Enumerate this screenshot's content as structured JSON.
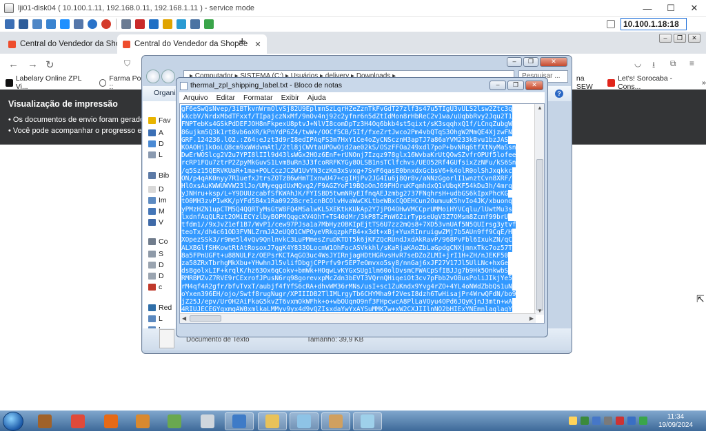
{
  "remote_desktop": {
    "title": "lji01-disk04 ( 10.100.1.11, 192.168.0.11, 192.168.1.11 ) - service mode",
    "address": "10.100.1.18:18",
    "window_controls": [
      "—",
      "☐",
      "✕"
    ]
  },
  "browser": {
    "tabs": [
      {
        "label": "Central do Vendedor da Shopee",
        "close": "✕"
      },
      {
        "label": "Central do Vendedor da Shopee",
        "close": "✕"
      }
    ],
    "new_tab": "+",
    "nav": {
      "back": "←",
      "forward": "→",
      "reload": "↻"
    },
    "bookmarks": [
      {
        "label": "Labelary Online ZPL Vi...",
        "color": "#111111"
      },
      {
        "label": "Farma Ponte ::",
        "color": "#555555"
      },
      {
        "label": "na SEW",
        "color": "#888888"
      },
      {
        "label": "Let's! Sorocaba - Cons...",
        "color": "#e1251b"
      }
    ],
    "page": {
      "heading": "Visualização de impressão",
      "bullets": [
        "Os documentos de envio foram gerado",
        "Você pode acompanhar o progresso en"
      ]
    }
  },
  "explorer": {
    "address": "▸ Computador ▸ SISTEMA (C:) ▸ Usuários ▸ delivery ▸ Downloads ▸",
    "search_placeholder": "Pesquisar ...",
    "command_label": "Organizar",
    "help_glyph": "?",
    "sidebar": [
      {
        "label": "Fav",
        "color": "#e8b400"
      },
      {
        "label": "A",
        "color": "#3b6fb5"
      },
      {
        "label": "D",
        "color": "#4a8ad4"
      },
      {
        "label": "L",
        "color": "#8a9ab0"
      },
      {
        "label": "Bib",
        "color": "#5c7aa6"
      },
      {
        "label": "D",
        "color": "#d8d8d8"
      },
      {
        "label": "Im",
        "color": "#5d8bc2"
      },
      {
        "label": "M",
        "color": "#4476b8"
      },
      {
        "label": "V",
        "color": "#3f6aa8"
      },
      {
        "label": "Co",
        "color": "#707c8c"
      },
      {
        "label": "S",
        "color": "#8e9aa8"
      },
      {
        "label": "D",
        "color": "#9aa4b0"
      },
      {
        "label": "D",
        "color": "#9aa4b0"
      },
      {
        "label": "c",
        "color": "#c0392b"
      },
      {
        "label": "Red",
        "color": "#2f6ea8"
      },
      {
        "label": "L",
        "color": "#5a88bf"
      },
      {
        "label": "L",
        "color": "#5a88bf"
      }
    ],
    "status": {
      "type": "Documento de Texto",
      "size": "Tamanho: 39,9 KB"
    }
  },
  "notepad": {
    "title": "thermal_zpl_shipping_label.txt - Bloco de notas",
    "menu": [
      "Arquivo",
      "Editar",
      "Formatar",
      "Exibir",
      "Ajuda"
    ],
    "lines": [
      "gF6eSwQsNvep/3iBTkvnWrmOlvSj82U9EplmnSzLqrHZeZznTkFvGdT27zlf3s47u5TIgU3vULS2lsw2Ztc3q",
      "kkcbV/NrdxMbdTFxxf/TIpajczNxMf/9nOv4nj92c2yfnr6n5dZtIdMon8rHbReC2v1wa/uUqbbRvy2Jqu2T1",
      "FNPTebKs4GSkPdDEFJOH8nFkpexU8ptvJ+NlVI8comDpTz3H4Oq6bkb4st5qixt/sK3sqqhxQ1f/LCnqZubgW",
      "86ujkm5Q3k1rt8vb6oXR/kPnYdP6Z4/twW+/OOCf5CB/5If/fxeZrtJwco2Pm4vbQTqS3OhgW2MmQE4XjzwFN",
      "GRF.124236.lO2.:Z64:eJzt3d9rI8edIPAqFS3m7HxY1Ce4oZyCNScznH3apTJ7a86aYVM233kBvu1bzJAS",
      "KOAOHj1kOoLQ8cm9xWWdvmAtl/2tl8jCWVtaUPOwOjd2ae02kS/OSzFFOa249xdl7poP+bvNRq6tfXtNyMaSsn",
      "DwErWOSlcg2V2u7YPI8lIIl9d43lsWGx2HOz6EnF+rUNOnj7Izqz978glx16WvbaKrUtQOwSZvfrOPUf5lofee",
      "rcRP1FQu7ztrP2ZpyMkGuvS1LvmBuRn3J3fcoRRFKYGy8OLSB1nsTClfchvs/UEO52Rf4GUfsixZzNFu/kS6Sn",
      "/q5Sz15QERVKUaR+1ma+POLCczJC2W1UvYN3czKm3xSvxg+7SvF6qasE0bnxdxGcbsV6+k4olR0olShJxqkkc",
      "ON/p4qAK0nyy7R1uefxJtrsZOTzB6wHmTIxnwU47+cgIHjPv2JG4Iu6j8Qr8v/aNNzGgorlI1wnztCvn8XRF/",
      "HlOxsAuKWWUWVW23lJo/UMyeggdUxMQvg2/F9AGZYoF19BQoOnJ69FHOruKFqmhdxQ1vUbqKF54kDu3h/4mrq",
      "yJNHru+ksp/L+Y9DUUzcabfSfKWAhJK/FYISBD5twmNRyEIfnqAEJzmbg2737FNqhrsH+udbGS6kIpxPhcKG",
      "tO0MH3zvPIwKK/pYFd5B4x1Ra0922Bcre1cnBCOlvHvaWwCKLtbeWBxCQOEHCun2OumuuK5hvIo4JK/xbuonq",
      "yPMzHZN1upCTM5Q4QQRTyMsGtW8FQ4MSalwKL5XEKtkKUkAp2Y7jPO4OHwVMCCprUMMoiHYVCqlu/lUwtMu3s",
      "lxdnfAqQLRzt2OMiECYzlbyBOPMQqgcKV4OhT+TS40dMr/3kP8TzPnW62irTypseUgV3Z7OMsm8Zcmf99brU",
      "tfdm1//9xJvZ1ef1B7/WvP1/cew97PJsa1a7MbHyzOBKIpEjtTS6U7zz2mQs8+7XD53vnUAf5N5QUIrsg3ytvf",
      "teoTx/dh4c61OD3FVNLZrmJA2eUQ01CWPOyeVRkqzpkFB4+x3dt+xBj+YuxRInruigwZMj7b5AUn9ff9CqE/H",
      "XOpezSSk3/r9me5l4vQv9QnlnvkC3LuPMmesZruDKTDT5k6jKFZQcRUndJxdAkRavP/968PvFbl6IxukZN/qC",
      "ALXBGlfSHKowtRtAtRosoxJ7qgK4Y833OLocmW1OhFocASVkkhl/sKaRjaKAoZbLaGpdgCNXjmnxTkc7oz57T",
      "8a5FPnUGFt+u88NULFz/OEPsrKCTAqGO3uc4WsJYIRnjagHDtHGRvsHvR7seDZoZLMI+jrI1H+ZH/nJEKF50",
      "za58ZRxTbrhgMkXbu+YHwhnJl5vlifDbgjCPPrfv9r5EP7eOmvxo5sy8/nnGaj6xJF27V17Jl5UlLNc+hxGe",
      "dsBgolxLIF+krqlK/hz63Ox6qCokv+bmWk+HOqwLvKYGxSUg1lm60olDvsmCFWACpSfIBJJg7b9Hk5OnkwbS",
      "RMRBMZvZ7RVE9rCExrofJPusN6rq98gorevxpMcZdn3bEVT3VQrnQHiqeiOt3cv7pFbb2vOBusPoliJIkjYe5",
      "rM4qf4A2gfr/bfvTvxT/aubjf4fYfS6cRA+dhvWM36rMNs/usI+sc1ZuKndx9Yvg4rZO+4YL4oNWdZbbQs1uN",
      "oYxen396EH/ojo/Swtf8rugNugr/XPIIIDB2TlIMLrgyTb6CHYMha9f2VesI8dzh6TwHisajPr4WrwQFdN/bo9",
      "jZ25J/epv/UrOH2AiFkaG5kvZT6vxmOkWFhk+o+wbOUqnO9nf3FHpcwcA8PlLaVOyu4OPd6JQyKjnJ3mtn+wA",
      "4RIUJECEGYqxmgAW0xmlkaLMMyv9yx4d9vQZIsxdaYwYxAYSuMMK7w+xW2CXJIIlnNO2bHIExYNEmnlaglagY",
      "b/vwZUqy7Tb0iu3ckdj24blGJMO4e3jYqUX2HyYlZ1q6GZS+3A+OkVHRTPONVR4QYtESQJDRTcq8WiVXVRUBOD",
      "L8D+mtZbHVNLx3Ix8Rx0zJ8DnxlyxmmODy9IqI+Zq7k3wF5KEGcmPUNbP33x1lwMy1ThtvgrcKyymkR49tg",
      "ZvGOTdDL+sqq9sOEA5z4VOMLKy/I6fYrbO0UZAoQ8yOhFFOs+lhIGp3A5yX3pp+2oP5Z4qD1GJ89xHmwxg7fe",
      "fqa9TxsO5Tx/amiFu9lrTf7Nd9xCyP6eO8Pc+w/ExAhdofthe3IlVEiBAhQoSIIGy3SBwpbptpuahAuZf2s+H"
    ]
  },
  "taskbar": {
    "apps": [
      {
        "name": "file-manager-icon",
        "color": "#a0622a"
      },
      {
        "name": "chrome-icon",
        "color": "#e04a3a"
      },
      {
        "name": "firefox-icon",
        "color": "#e66a16"
      },
      {
        "name": "user-app-icon",
        "color": "#d9892f"
      },
      {
        "name": "tools-icon",
        "color": "#6aa84f"
      },
      {
        "name": "printer-icon",
        "color": "#cfd6dd"
      },
      {
        "name": "vida-link-icon",
        "color": "#3e7bc7"
      },
      {
        "name": "folder-icon",
        "color": "#e8c25a"
      },
      {
        "name": "notepad-icon",
        "color": "#8ec3e6"
      },
      {
        "name": "paint-icon",
        "color": "#d0a060"
      },
      {
        "name": "notepad-icon-2",
        "color": "#9ed0ea"
      }
    ],
    "tray_colors": [
      "#ffd35a",
      "#3b8a3b",
      "#4677c8",
      "#7a7a7a",
      "#c33",
      "#3a6fc4",
      "#3aa54a"
    ],
    "time": "11:34",
    "date": "19/09/2024"
  }
}
